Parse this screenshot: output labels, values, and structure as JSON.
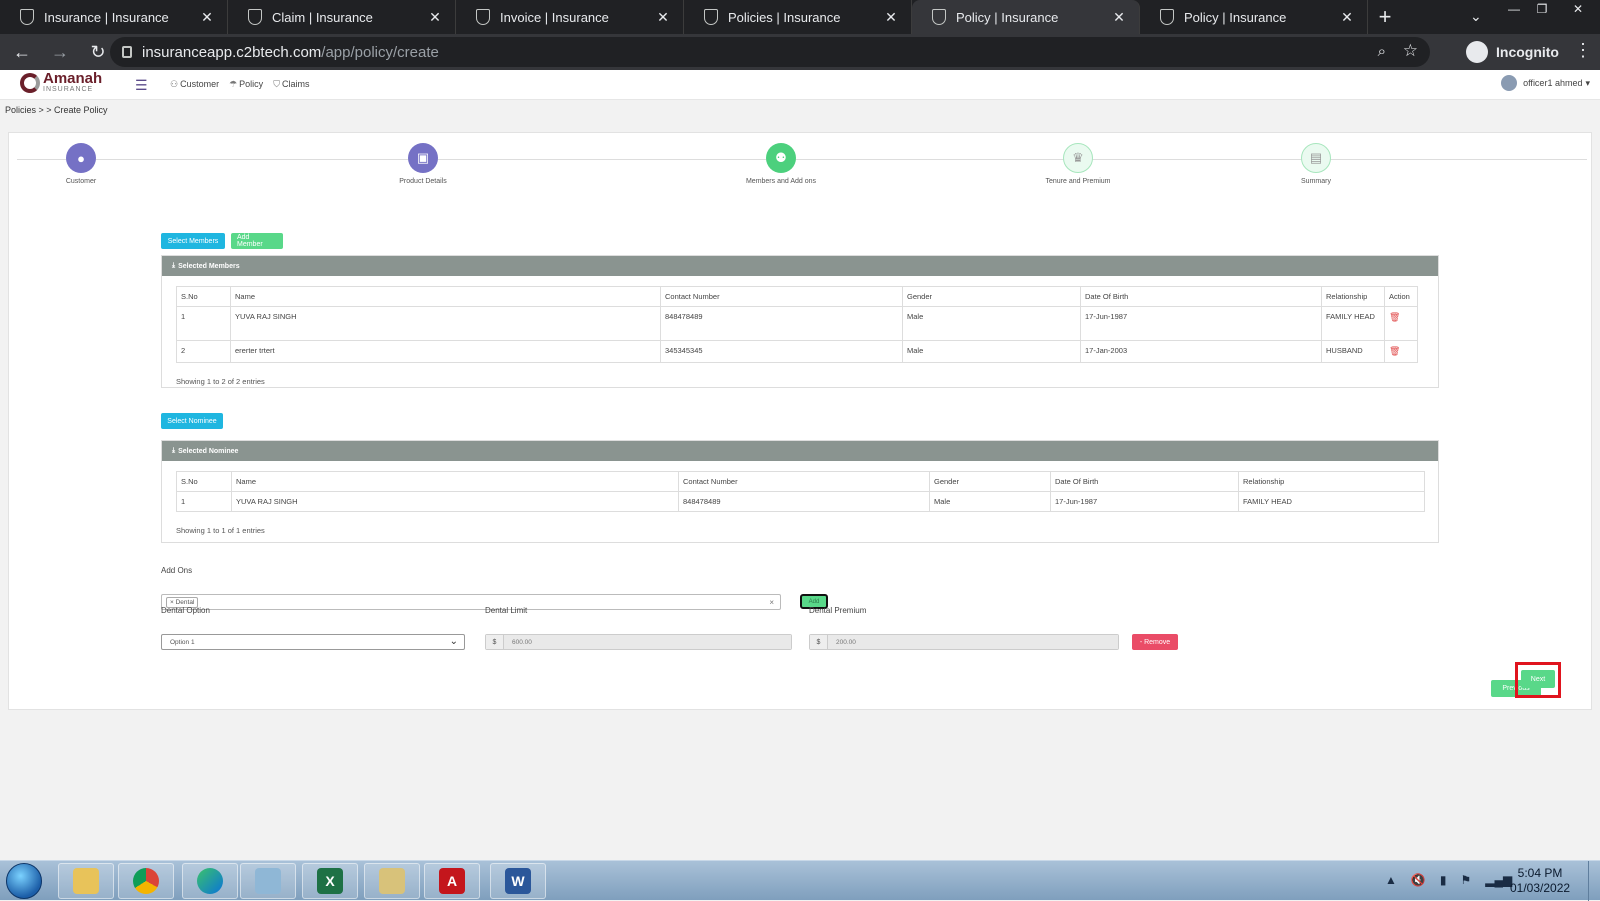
{
  "browser": {
    "tabs": [
      {
        "title": "Insurance | Insurance"
      },
      {
        "title": "Claim | Insurance"
      },
      {
        "title": "Invoice | Insurance"
      },
      {
        "title": "Policies | Insurance"
      },
      {
        "title": "Policy | Insurance"
      },
      {
        "title": "Policy | Insurance"
      }
    ],
    "url_host": "insuranceapp.c2btech.com",
    "url_path": "/app/policy/create",
    "profile": "Incognito"
  },
  "app": {
    "logo_name": "Amanah",
    "logo_sub": "INSURANCE",
    "nav": {
      "customer": "Customer",
      "policy": "Policy",
      "claims": "Claims"
    },
    "user": "officer1 ahmed"
  },
  "breadcrumb": {
    "parent": "Policies",
    "sep": " > > ",
    "current": "Create Policy"
  },
  "steps": [
    {
      "label": "Customer"
    },
    {
      "label": "Product Details"
    },
    {
      "label": "Members and Add ons"
    },
    {
      "label": "Tenure and Premium"
    },
    {
      "label": "Summary"
    }
  ],
  "buttons": {
    "select_members": "Select Members",
    "add_member": "Add Member",
    "select_nominee": "Select Nominee",
    "add": "Add",
    "remove": "- Remove",
    "previous": "Previous",
    "next": "Next"
  },
  "members": {
    "title": "Selected Members",
    "columns": [
      "S.No",
      "Name",
      "Contact Number",
      "Gender",
      "Date Of Birth",
      "Relationship",
      "Action"
    ],
    "rows": [
      {
        "sno": "1",
        "name": "YUVA RAJ SINGH",
        "contact": "848478489",
        "gender": "Male",
        "dob": "17-Jun-1987",
        "relationship": "FAMILY HEAD"
      },
      {
        "sno": "2",
        "name": "ererter trtert",
        "contact": "345345345",
        "gender": "Male",
        "dob": "17-Jan-2003",
        "relationship": "HUSBAND"
      }
    ],
    "showing": "Showing 1 to 2 of 2 entries"
  },
  "nominees": {
    "title": "Selected Nominee",
    "columns": [
      "S.No",
      "Name",
      "Contact Number",
      "Gender",
      "Date Of Birth",
      "Relationship"
    ],
    "rows": [
      {
        "sno": "1",
        "name": "YUVA RAJ SINGH",
        "contact": "848478489",
        "gender": "Male",
        "dob": "17-Jun-1987",
        "relationship": "FAMILY HEAD"
      }
    ],
    "showing": "Showing 1 to 1 of 1 entries"
  },
  "addons": {
    "label": "Add Ons",
    "chip": "× Dental",
    "clear": "×",
    "dental_option_label": "Dental Option",
    "dental_option_value": "Option 1",
    "dental_limit_label": "Dental Limit",
    "dental_limit_currency": "$",
    "dental_limit_value": "600.00",
    "dental_premium_label": "Dental Premium",
    "dental_premium_currency": "$",
    "dental_premium_value": "200.00"
  },
  "taskbar": {
    "time": "5:04 PM",
    "date": "01/03/2022"
  },
  "colors": {
    "step_done": "#7571c5",
    "step_current": "#4cd07d",
    "btn_blue": "#1fb6e0",
    "btn_green": "#59d889",
    "btn_red": "#ea4c67",
    "highlight": "#e0141e"
  }
}
